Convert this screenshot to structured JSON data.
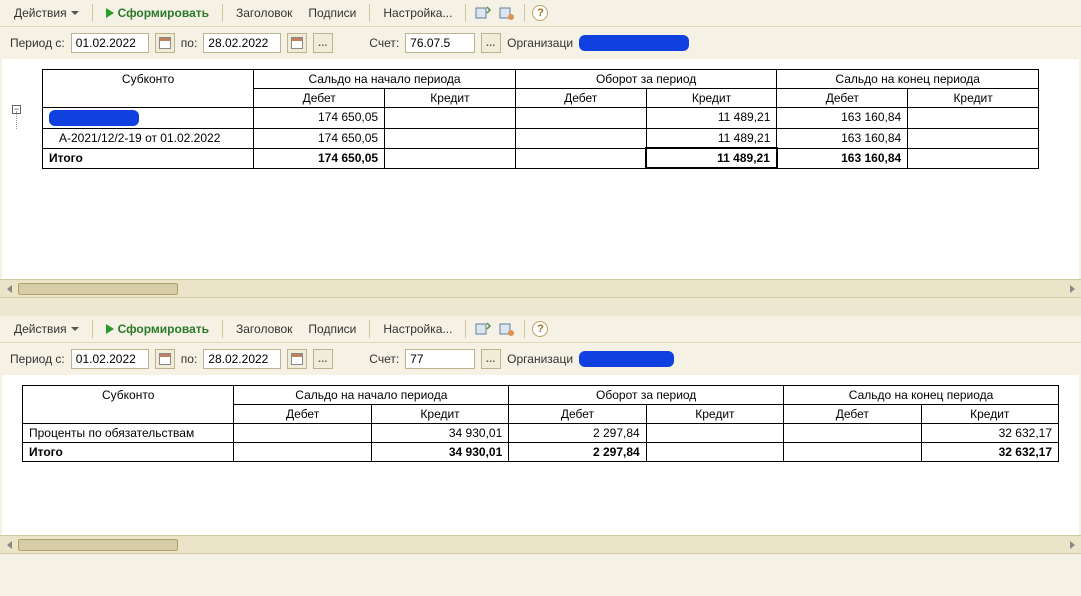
{
  "toolbar": {
    "actions": "Действия",
    "generate": "Сформировать",
    "header": "Заголовок",
    "signatures": "Подписи",
    "settings": "Настройка..."
  },
  "params": {
    "period_from_lbl": "Период с:",
    "to_lbl": "по:",
    "account_lbl": "Счет:",
    "org_lbl": "Организаци"
  },
  "top": {
    "from": "01.02.2022",
    "to": "28.02.2022",
    "account": "76.07.5",
    "columns": {
      "subkonto": "Субконто",
      "start": "Сальдо на начало периода",
      "turn": "Оборот за период",
      "end": "Сальдо на конец периода",
      "debit": "Дебет",
      "credit": "Кредит"
    },
    "rows": [
      {
        "name": "",
        "sd": "174 650,05",
        "sk": "",
        "td": "",
        "tk": "11 489,21",
        "ed": "163 160,84",
        "ek": ""
      },
      {
        "name": "А-2021/12/2-19 от 01.02.2022",
        "sd": "174 650,05",
        "sk": "",
        "td": "",
        "tk": "11 489,21",
        "ed": "163 160,84",
        "ek": ""
      }
    ],
    "total_lbl": "Итого",
    "total": {
      "sd": "174 650,05",
      "sk": "",
      "td": "",
      "tk": "11 489,21",
      "ed": "163 160,84",
      "ek": ""
    }
  },
  "bottom": {
    "from": "01.02.2022",
    "to": "28.02.2022",
    "account": "77",
    "columns": {
      "subkonto": "Субконто",
      "start": "Сальдо на начало периода",
      "turn": "Оборот за период",
      "end": "Сальдо на конец периода",
      "debit": "Дебет",
      "credit": "Кредит"
    },
    "rows": [
      {
        "name": "Проценты по обязательствам",
        "sd": "",
        "sk": "34 930,01",
        "td": "2 297,84",
        "tk": "",
        "ed": "",
        "ek": "32 632,17"
      }
    ],
    "total_lbl": "Итого",
    "total": {
      "sd": "",
      "sk": "34 930,01",
      "td": "2 297,84",
      "tk": "",
      "ed": "",
      "ek": "32 632,17"
    }
  }
}
